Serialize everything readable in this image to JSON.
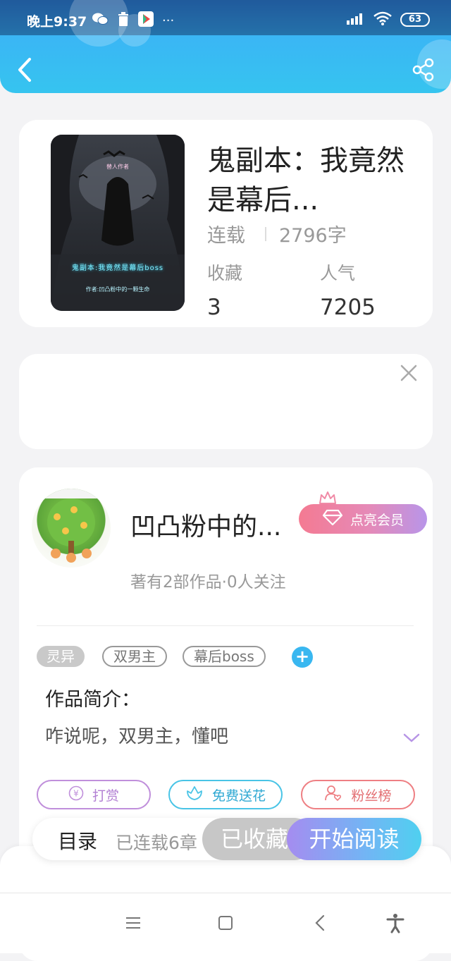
{
  "status_bar": {
    "time": "晚上9:37",
    "battery": "63",
    "more": "···"
  },
  "header": {
    "back_icon": "chevron-left-icon",
    "share_icon": "share-icon"
  },
  "book": {
    "title": "鬼副本：我竟然是幕后...",
    "status": "连载",
    "word_count": "2796字",
    "favorites_label": "收藏",
    "favorites_value": "3",
    "popularity_label": "人气",
    "popularity_value": "7205",
    "cover": {
      "top_text": "替人作者",
      "title_text": "鬼副本:我竟然是幕后boss",
      "sub_text": "作者:凹凸粉中的一颗生命"
    }
  },
  "author": {
    "name": "凹凸粉中的...",
    "meta": "著有2部作品·0人关注",
    "vip_button": "点亮会员"
  },
  "tags": [
    "灵异",
    "双男主",
    "幕后boss"
  ],
  "intro": {
    "label": "作品简介：",
    "text": "咋说呢，双男主，懂吧"
  },
  "actions": {
    "tip": "打赏",
    "flower": "免费送花",
    "fans": "粉丝榜"
  },
  "bottom_bar": {
    "toc": "目录",
    "toc_count": "已连载6章",
    "collected": "已收藏",
    "read": "开始阅读"
  },
  "colors": {
    "header_blue": "#36c4ef",
    "vip_pink": "#f47a92",
    "read_gradient_start": "#a58cf0",
    "read_gradient_end": "#4fd0f0"
  }
}
